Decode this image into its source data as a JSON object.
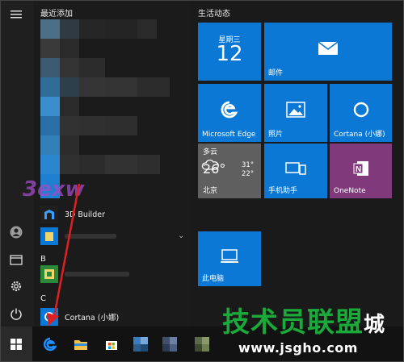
{
  "applist": {
    "recently_added": "最近添加",
    "section_b": "B",
    "section_c": "C",
    "apps": {
      "builder": "3D Builder",
      "cortana": "Cortana (小娜)"
    }
  },
  "tiles": {
    "header": "生活动态",
    "calendar": {
      "weekday": "星期三",
      "day": "12"
    },
    "mail": "邮件",
    "edge": "Microsoft Edge",
    "photos": "照片",
    "cortana": "Cortana (小娜)",
    "weather": {
      "condition": "多云",
      "temp": "26°",
      "high": "31°",
      "low": "22°",
      "city": "北京"
    },
    "phone": "手机助手",
    "onenote": "OneNote",
    "pc": "此电脑"
  },
  "watermark": {
    "site_cn": "技术员联盟",
    "site_suffix": "城",
    "url": "www.jsgho.com",
    "logo": "3exw"
  },
  "colors": {
    "tile_blue": "#0a78d4",
    "onenote_purple": "#80397b",
    "weather_gray": "#606060",
    "arrow_red": "#e02020",
    "watermark_green": "#1aaa3a"
  }
}
